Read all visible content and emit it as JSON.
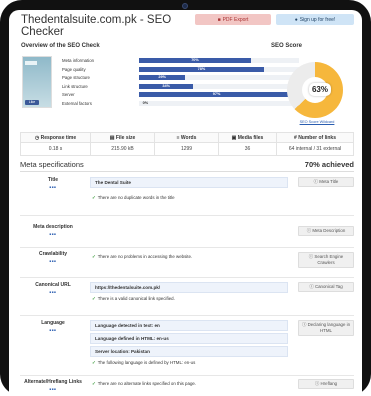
{
  "page": {
    "title": "Thedentalsuite.com.pk - SEO Checker"
  },
  "toolbar": {
    "pdf_label": "PDF Export",
    "signup_label": "Sign up for free!"
  },
  "overview": {
    "heading": "Overview of the SEO Check",
    "fb_like": "Like",
    "metrics": [
      {
        "label": "Meta information",
        "percent": 70,
        "value_text": "70%"
      },
      {
        "label": "Page quality",
        "percent": 78,
        "value_text": "78%"
      },
      {
        "label": "Page structure",
        "percent": 29,
        "value_text": "29%"
      },
      {
        "label": "Link structure",
        "percent": 34,
        "value_text": "34%"
      },
      {
        "label": "Server",
        "percent": 97,
        "value_text": "97%"
      },
      {
        "label": "External factors",
        "percent": 0,
        "value_text": "0%"
      }
    ]
  },
  "score": {
    "heading": "SEO Score",
    "value": 63,
    "value_text": "63%",
    "link": "SEO Score Wildcard",
    "colors": {
      "fill": "#f6b73c",
      "track": "#ececec"
    }
  },
  "stats": [
    {
      "label": "Response time",
      "value": "0.18 s",
      "icon": "clock-icon"
    },
    {
      "label": "File size",
      "value": "215.90 kB",
      "icon": "file-icon"
    },
    {
      "label": "Words",
      "value": "1299",
      "icon": "words-icon"
    },
    {
      "label": "Media files",
      "value": "36",
      "icon": "image-icon"
    },
    {
      "label": "Number of links",
      "value": "64 internal / 31 external",
      "icon": "link-icon"
    }
  ],
  "meta": {
    "heading": "Meta specifications",
    "achieved": "70% achieved",
    "rows": [
      {
        "name": "Title",
        "box": "The Dental Suite",
        "note": "There are no duplicate words in the title",
        "info": "Meta Title"
      },
      {
        "name": "Meta description",
        "box": "",
        "note": "",
        "info": "Meta Description"
      },
      {
        "name": "Crawlability",
        "box": "",
        "note": "There are no problems in accessing the website.",
        "info": "Search Engine Crawlers"
      },
      {
        "name": "Canonical URL",
        "box": "https://thedentalsuite.com.pk/",
        "note": "There is a valid canonical link specified.",
        "info": "Canonical Tag"
      },
      {
        "name": "Language",
        "boxes": [
          "Language detected in text: en",
          "Language defined in HTML: en-us",
          "Server location: Pakistan"
        ],
        "note": "The following language is defined by HTML: en-us",
        "info": "Declaring language in HTML"
      },
      {
        "name": "Alternate/Hreflang Links",
        "box": "",
        "note": "There are no alternate links specified on this page.",
        "info": "Hreflang"
      }
    ]
  }
}
